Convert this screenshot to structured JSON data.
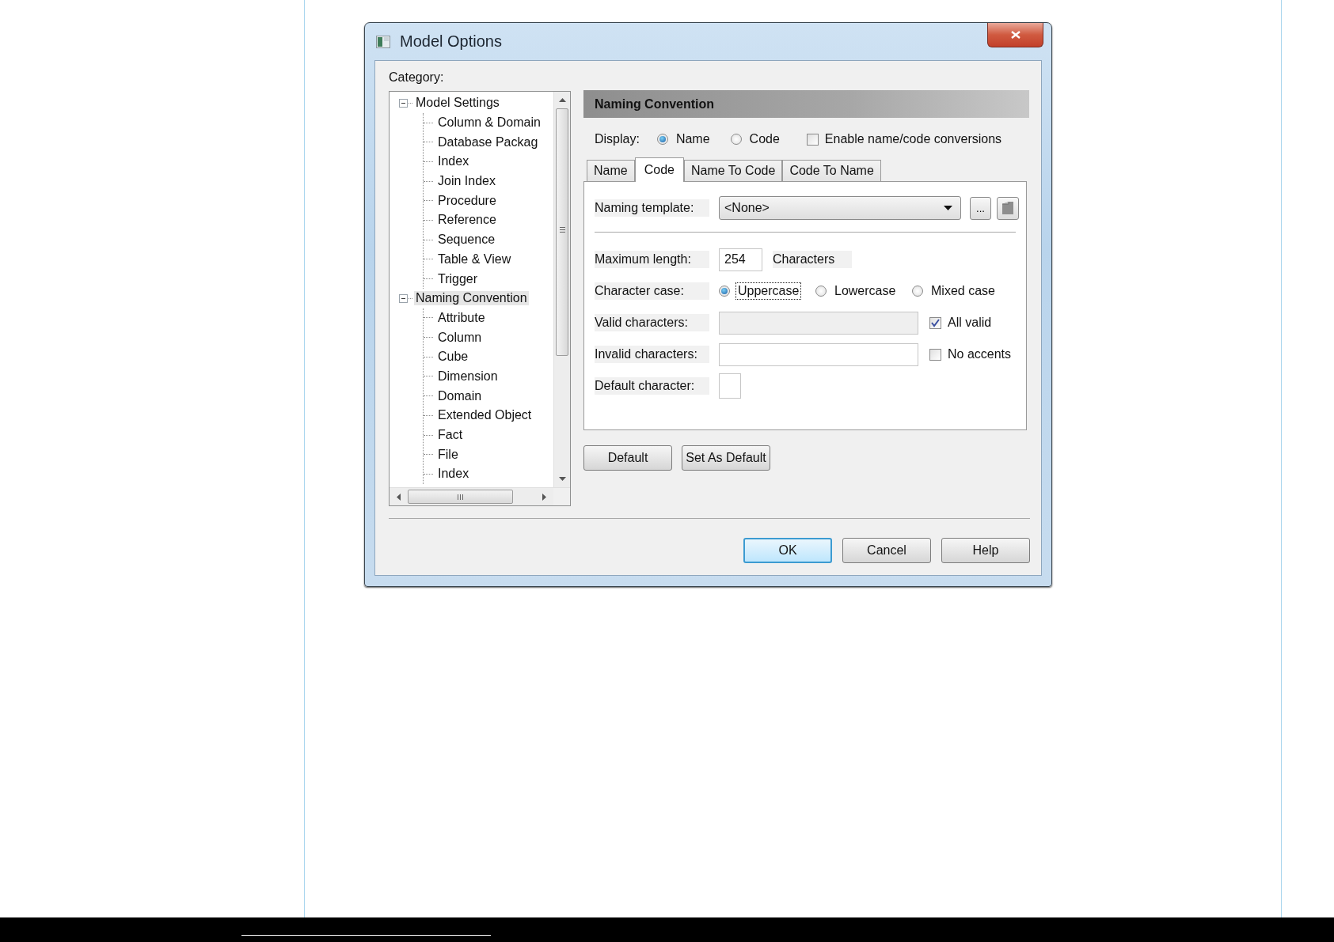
{
  "window": {
    "title": "Model Options"
  },
  "category": {
    "label": "Category:",
    "tree": [
      {
        "label": "Model Settings",
        "expanded": true,
        "selected": false,
        "children": [
          {
            "label": "Column & Domain"
          },
          {
            "label": "Database Packag"
          },
          {
            "label": "Index"
          },
          {
            "label": "Join Index"
          },
          {
            "label": "Procedure"
          },
          {
            "label": "Reference"
          },
          {
            "label": "Sequence"
          },
          {
            "label": "Table & View"
          },
          {
            "label": "Trigger"
          }
        ]
      },
      {
        "label": "Naming Convention",
        "expanded": true,
        "selected": true,
        "children": [
          {
            "label": "Attribute"
          },
          {
            "label": "Column"
          },
          {
            "label": "Cube"
          },
          {
            "label": "Dimension"
          },
          {
            "label": "Domain"
          },
          {
            "label": "Extended Object"
          },
          {
            "label": "Fact"
          },
          {
            "label": "File"
          },
          {
            "label": "Index"
          }
        ]
      }
    ]
  },
  "panel": {
    "title": "Naming Convention",
    "display": {
      "label": "Display:",
      "options": [
        {
          "label": "Name",
          "selected": true
        },
        {
          "label": "Code",
          "selected": false
        }
      ],
      "conversion": {
        "label": "Enable name/code conversions",
        "checked": false
      }
    },
    "tabs": [
      {
        "label": "Name",
        "selected": false
      },
      {
        "label": "Code",
        "selected": true
      },
      {
        "label": "Name To Code",
        "selected": false
      },
      {
        "label": "Code To Name",
        "selected": false
      }
    ],
    "naming_template": {
      "label": "Naming template:",
      "value": "<None>",
      "browse": "..."
    },
    "maximum_length": {
      "label": "Maximum length:",
      "value": "254",
      "unit": "Characters"
    },
    "character_case": {
      "label": "Character case:",
      "options": [
        {
          "label": "Uppercase",
          "selected": true,
          "focused": true
        },
        {
          "label": "Lowercase",
          "selected": false,
          "focused": false
        },
        {
          "label": "Mixed case",
          "selected": false,
          "focused": false
        }
      ]
    },
    "valid_characters": {
      "label": "Valid characters:",
      "disabled": true,
      "option": {
        "label": "All valid",
        "checked": true
      }
    },
    "invalid_characters": {
      "label": "Invalid characters:",
      "disabled": false,
      "option": {
        "label": "No accents",
        "checked": false
      }
    },
    "default_character": {
      "label": "Default character:"
    },
    "buttons": [
      "Default",
      "Set As Default"
    ]
  },
  "buttons": [
    {
      "label": "OK",
      "default": true
    },
    {
      "label": "Cancel",
      "default": false
    },
    {
      "label": "Help",
      "default": false
    }
  ]
}
